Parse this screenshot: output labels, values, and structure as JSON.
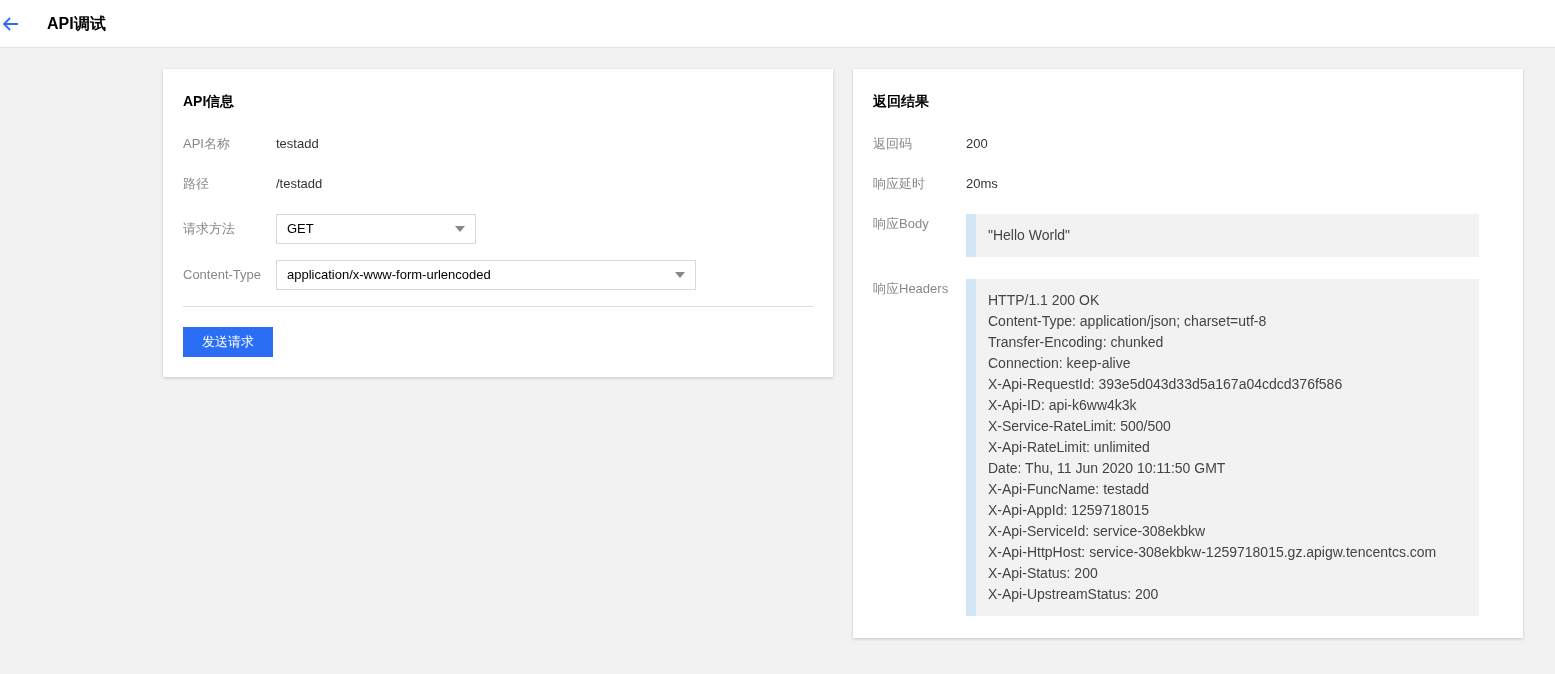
{
  "header": {
    "title": "API调试"
  },
  "api_info": {
    "title": "API信息",
    "fields": [
      {
        "kind": "text",
        "label": "API名称",
        "value": "testadd"
      },
      {
        "kind": "text",
        "label": "路径",
        "value": "/testadd"
      },
      {
        "kind": "select",
        "label": "请求方法",
        "value": "GET"
      },
      {
        "kind": "wide_select",
        "label": "Content-Type",
        "value": "application/x-www-form-urlencoded"
      }
    ],
    "send_button": "发送请求"
  },
  "result": {
    "title": "返回结果",
    "fields": [
      {
        "kind": "text",
        "label": "返回码",
        "value": "200"
      },
      {
        "kind": "text",
        "label": "响应延时",
        "value": "20ms"
      },
      {
        "kind": "code",
        "label": "响应Body",
        "lines": [
          "\"Hello World\""
        ]
      },
      {
        "kind": "code",
        "label": "响应Headers",
        "lines": [
          "HTTP/1.1 200 OK",
          "Content-Type: application/json; charset=utf-8",
          "Transfer-Encoding: chunked",
          "Connection: keep-alive",
          "X-Api-RequestId: 393e5d043d33d5a167a04cdcd376f586",
          "X-Api-ID: api-k6ww4k3k",
          "X-Service-RateLimit: 500/500",
          "X-Api-RateLimit: unlimited",
          "Date: Thu, 11 Jun 2020 10:11:50 GMT",
          "X-Api-FuncName: testadd",
          "X-Api-AppId: 1259718015",
          "X-Api-ServiceId: service-308ekbkw",
          "X-Api-HttpHost: service-308ekbkw-1259718015.gz.apigw.tencentcs.com",
          "X-Api-Status: 200",
          "X-Api-UpstreamStatus: 200"
        ]
      }
    ]
  }
}
